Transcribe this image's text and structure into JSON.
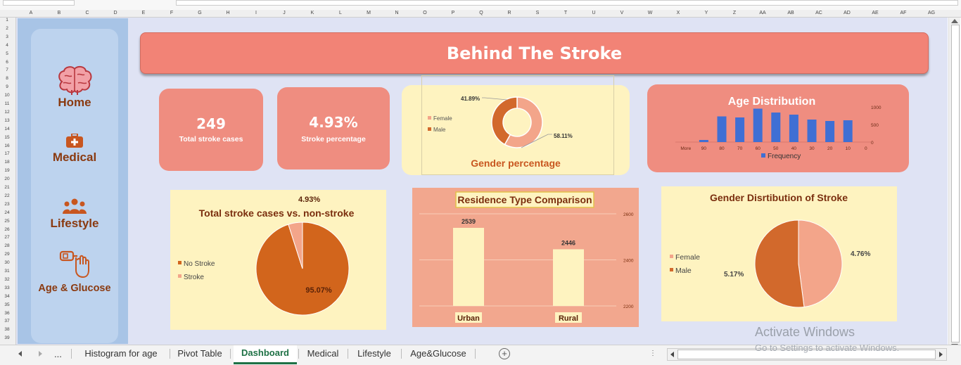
{
  "sheet": {
    "columns": [
      "A",
      "B",
      "C",
      "D",
      "E",
      "F",
      "G",
      "H",
      "I",
      "J",
      "K",
      "L",
      "M",
      "N",
      "O",
      "P",
      "Q",
      "R",
      "S",
      "T",
      "U",
      "V",
      "W",
      "X",
      "Y",
      "Z",
      "AA",
      "AB",
      "AC",
      "AD",
      "AE",
      "AF",
      "AG"
    ],
    "rows": [
      "1",
      "2",
      "3",
      "4",
      "5",
      "6",
      "7",
      "8",
      "9",
      "10",
      "11",
      "12",
      "13",
      "14",
      "15",
      "16",
      "17",
      "18",
      "19",
      "20",
      "21",
      "22",
      "23",
      "24",
      "25",
      "26",
      "27",
      "28",
      "29",
      "30",
      "31",
      "32",
      "33",
      "34",
      "35",
      "36",
      "37",
      "38",
      "39"
    ]
  },
  "sidebar": {
    "home": "Home",
    "medical": "Medical",
    "lifestyle": "Lifestyle",
    "age_glucose": "Age & Glucose"
  },
  "title": "Behind The Stroke",
  "kpis": {
    "total_value": "249",
    "total_label": "Total stroke cases",
    "pct_value": "4.93%",
    "pct_label": "Stroke percentage"
  },
  "colors": {
    "accent": "#f28376",
    "kpi": "#ef8d80",
    "female": "#f3a58a",
    "male": "#d2692c",
    "bar_blue": "#3f6fd4",
    "cream": "#fef3c0",
    "brown_text": "#8a3a10"
  },
  "chart_data": [
    {
      "type": "pie",
      "title": "Gender percentage",
      "variant": "donut",
      "labels": [
        "Female",
        "Male"
      ],
      "values": [
        58.11,
        41.89
      ],
      "data_labels": [
        "58.11%",
        "41.89%"
      ],
      "legend": "left"
    },
    {
      "type": "bar",
      "title": "Age Distribution",
      "categories": [
        "More",
        "90",
        "80",
        "70",
        "60",
        "50",
        "40",
        "30",
        "20",
        "10",
        "0"
      ],
      "series": [
        {
          "name": "Frequency",
          "values": [
            0,
            60,
            730,
            700,
            950,
            840,
            780,
            640,
            600,
            620,
            0
          ]
        }
      ],
      "y_ticks": [
        "1000",
        "500",
        "0"
      ],
      "ylim": [
        0,
        1000
      ],
      "legend": "bottom"
    },
    {
      "type": "pie",
      "title": "Total stroke cases vs. non-stroke",
      "labels": [
        "No Stroke",
        "Stroke"
      ],
      "values": [
        95.07,
        4.93
      ],
      "data_labels": [
        "95.07%",
        "4.93%"
      ],
      "legend": "left"
    },
    {
      "type": "bar",
      "title": "Residence Type Comparison",
      "categories": [
        "Urban",
        "Rural"
      ],
      "values": [
        2539,
        2446
      ],
      "data_labels": [
        "2539",
        "2446"
      ],
      "y_ticks": [
        "2600",
        "2400",
        "2200"
      ],
      "ylim": [
        2200,
        2600
      ]
    },
    {
      "type": "pie",
      "title": "Gender Disrtibution of Stroke",
      "labels": [
        "Female",
        "Male"
      ],
      "values": [
        4.76,
        5.17
      ],
      "data_labels": [
        "4.76%",
        "5.17%"
      ],
      "legend": "left"
    }
  ],
  "tabs": {
    "ellipsis": "...",
    "items": [
      "Histogram for age",
      "Pivot Table",
      "Dashboard",
      "Medical",
      "Lifestyle",
      "Age&Glucose"
    ],
    "active": "Dashboard"
  },
  "watermark": {
    "line1": "Activate Windows",
    "line2": "Go to Settings to activate Windows."
  }
}
